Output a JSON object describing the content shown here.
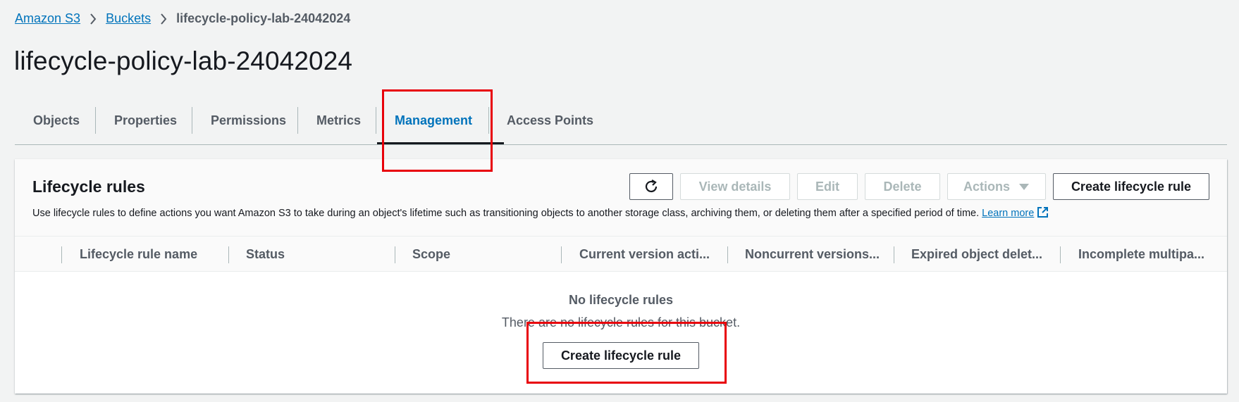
{
  "breadcrumb": {
    "items": [
      "Amazon S3",
      "Buckets"
    ],
    "current": "lifecycle-policy-lab-24042024"
  },
  "page": {
    "title": "lifecycle-policy-lab-24042024"
  },
  "tabs": [
    {
      "label": "Objects"
    },
    {
      "label": "Properties"
    },
    {
      "label": "Permissions"
    },
    {
      "label": "Metrics"
    },
    {
      "label": "Management"
    },
    {
      "label": "Access Points"
    }
  ],
  "active_tab": "Management",
  "lifecycle": {
    "title": "Lifecycle rules",
    "description": "Use lifecycle rules to define actions you want Amazon S3 to take during an object's lifetime such as transitioning objects to another storage class, archiving them, or deleting them after a specified period of time.",
    "learn_more": "Learn more",
    "buttons": {
      "view_details": "View details",
      "edit": "Edit",
      "delete": "Delete",
      "actions": "Actions",
      "create": "Create lifecycle rule"
    },
    "columns": [
      "Lifecycle rule name",
      "Status",
      "Scope",
      "Current version acti...",
      "Noncurrent versions...",
      "Expired object delet...",
      "Incomplete multipa..."
    ],
    "empty": {
      "title": "No lifecycle rules",
      "message": "There are no lifecycle rules for this bucket.",
      "button": "Create lifecycle rule"
    }
  },
  "colors": {
    "link": "#0073bb",
    "highlight": "#e8000a",
    "text": "#16191f",
    "muted": "#545b64"
  }
}
